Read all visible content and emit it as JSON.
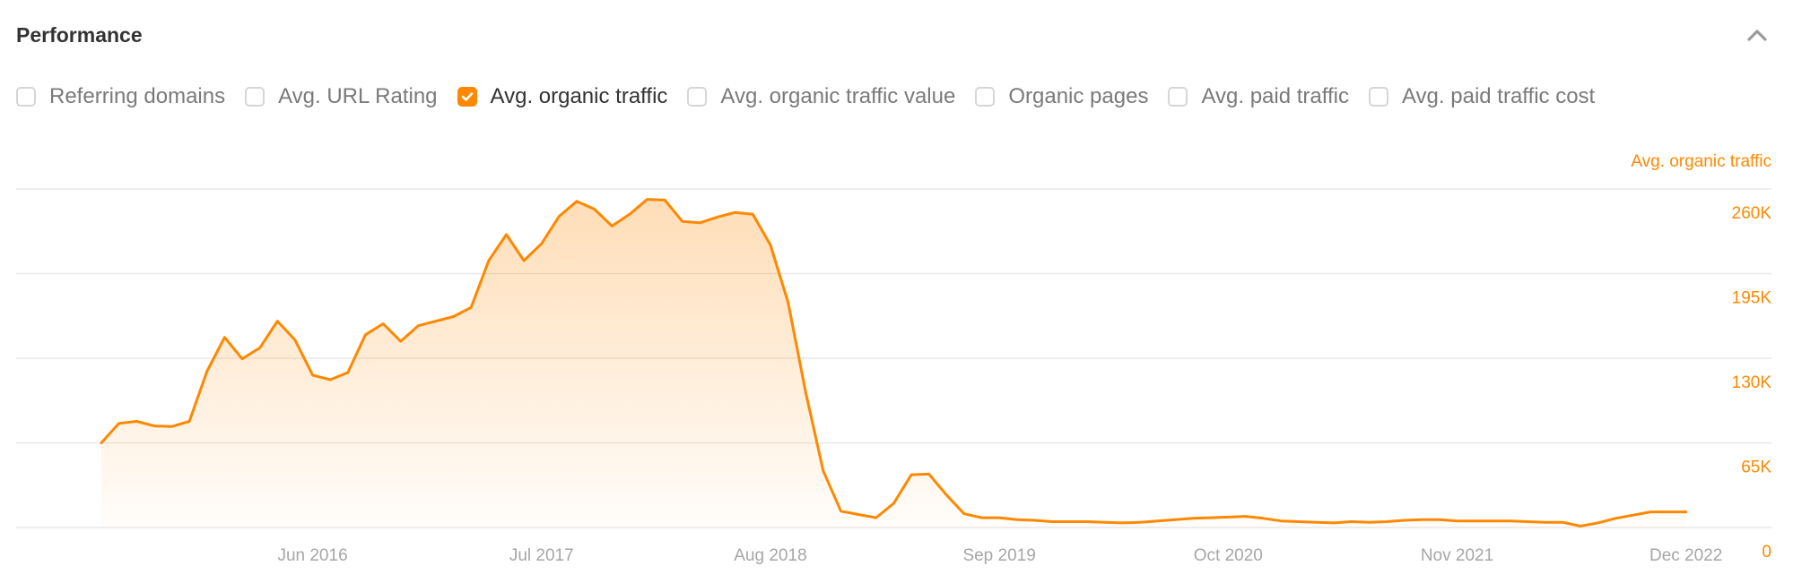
{
  "header": {
    "title": "Performance",
    "collapse_icon": "chevron-up-icon"
  },
  "metrics": [
    {
      "label": "Referring domains",
      "checked": false
    },
    {
      "label": "Avg. URL Rating",
      "checked": false
    },
    {
      "label": "Avg. organic traffic",
      "checked": true
    },
    {
      "label": "Avg. organic traffic value",
      "checked": false
    },
    {
      "label": "Organic pages",
      "checked": false
    },
    {
      "label": "Avg. paid traffic",
      "checked": false
    },
    {
      "label": "Avg. paid traffic cost",
      "checked": false
    }
  ],
  "colors": {
    "accent": "#ff8800",
    "grid": "#e8e8e8",
    "axis_text": "#a6a6a6"
  },
  "chart_data": {
    "type": "area",
    "title": "",
    "series_label": "Avg. organic traffic",
    "xlabel": "",
    "ylabel": "Avg. organic traffic",
    "y_axis_position": "right",
    "ylim": [
      0,
      260000
    ],
    "yticks": [
      0,
      65000,
      130000,
      195000,
      260000
    ],
    "ytick_labels": [
      "0",
      "65K",
      "130K",
      "195K",
      "260K"
    ],
    "xtick_labels": [
      "Jun 2016",
      "Jul 2017",
      "Aug 2018",
      "Sep 2019",
      "Oct 2020",
      "Nov 2021",
      "Dec 2022"
    ],
    "xtick_months": [
      "2016-06",
      "2017-07",
      "2018-08",
      "2019-09",
      "2020-10",
      "2021-11",
      "2022-12"
    ],
    "grid": true,
    "start_month": "2015-06",
    "end_month": "2022-12",
    "series": [
      {
        "name": "Avg. organic traffic",
        "values": [
          65000,
          80000,
          81500,
          78000,
          77500,
          81500,
          120000,
          146000,
          129500,
          138000,
          158500,
          144000,
          117000,
          113500,
          119000,
          148000,
          156500,
          143000,
          155000,
          158500,
          162000,
          169000,
          205000,
          225000,
          205000,
          218000,
          239000,
          250500,
          244500,
          231500,
          240500,
          252000,
          251500,
          235000,
          234000,
          238500,
          242000,
          240500,
          217000,
          173000,
          104000,
          43500,
          12500,
          10000,
          7500,
          18500,
          40500,
          41000,
          25000,
          10500,
          7500,
          7500,
          6000,
          5500,
          4500,
          4500,
          4500,
          4000,
          3500,
          4000,
          5000,
          6000,
          7000,
          7500,
          8000,
          8500,
          7000,
          5000,
          4500,
          4000,
          3500,
          4500,
          4000,
          4500,
          5500,
          6000,
          6000,
          5000,
          5000,
          5000,
          5000,
          4500,
          4000,
          4000,
          1000,
          3500,
          7000,
          9500,
          12000,
          12000,
          12000
        ]
      }
    ]
  }
}
